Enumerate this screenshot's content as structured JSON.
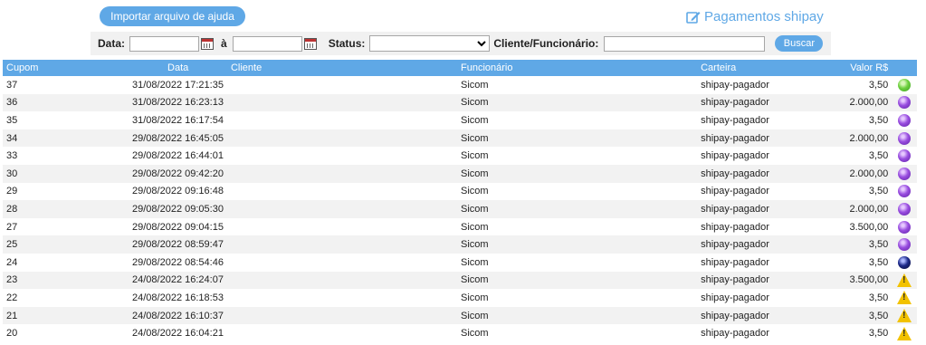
{
  "header": {
    "import_label": "Importar arquivo de ajuda",
    "shipay_label": "Pagamentos shipay",
    "shipay_icon": "edit-icon",
    "accent_color": "#5fa8e6"
  },
  "filters": {
    "data_label": "Data:",
    "data_from_value": "",
    "a_label": "à",
    "data_to_value": "",
    "status_label": "Status:",
    "status_selected": "",
    "cliente_label": "Cliente/Funcionário:",
    "cliente_value": "",
    "buscar_label": "Buscar"
  },
  "table": {
    "headers": {
      "cupom": "Cupom",
      "data": "Data",
      "cliente": "Cliente",
      "funcionario": "Funcionário",
      "carteira": "Carteira",
      "valor": "Valor R$"
    },
    "rows": [
      {
        "cupom": "37",
        "data": "31/08/2022 17:21:35",
        "cliente": "",
        "funcionario": "Sicom",
        "carteira": "shipay-pagador",
        "valor": "3,50",
        "status": "green"
      },
      {
        "cupom": "36",
        "data": "31/08/2022 16:23:13",
        "cliente": "",
        "funcionario": "Sicom",
        "carteira": "shipay-pagador",
        "valor": "2.000,00",
        "status": "purple"
      },
      {
        "cupom": "35",
        "data": "31/08/2022 16:17:54",
        "cliente": "",
        "funcionario": "Sicom",
        "carteira": "shipay-pagador",
        "valor": "3,50",
        "status": "purple"
      },
      {
        "cupom": "34",
        "data": "29/08/2022 16:45:05",
        "cliente": "",
        "funcionario": "Sicom",
        "carteira": "shipay-pagador",
        "valor": "2.000,00",
        "status": "purple"
      },
      {
        "cupom": "33",
        "data": "29/08/2022 16:44:01",
        "cliente": "",
        "funcionario": "Sicom",
        "carteira": "shipay-pagador",
        "valor": "3,50",
        "status": "purple"
      },
      {
        "cupom": "30",
        "data": "29/08/2022 09:42:20",
        "cliente": "",
        "funcionario": "Sicom",
        "carteira": "shipay-pagador",
        "valor": "2.000,00",
        "status": "purple"
      },
      {
        "cupom": "29",
        "data": "29/08/2022 09:16:48",
        "cliente": "",
        "funcionario": "Sicom",
        "carteira": "shipay-pagador",
        "valor": "3,50",
        "status": "purple"
      },
      {
        "cupom": "28",
        "data": "29/08/2022 09:05:30",
        "cliente": "",
        "funcionario": "Sicom",
        "carteira": "shipay-pagador",
        "valor": "2.000,00",
        "status": "purple"
      },
      {
        "cupom": "27",
        "data": "29/08/2022 09:04:15",
        "cliente": "",
        "funcionario": "Sicom",
        "carteira": "shipay-pagador",
        "valor": "3.500,00",
        "status": "purple"
      },
      {
        "cupom": "25",
        "data": "29/08/2022 08:59:47",
        "cliente": "",
        "funcionario": "Sicom",
        "carteira": "shipay-pagador",
        "valor": "3,50",
        "status": "purple"
      },
      {
        "cupom": "24",
        "data": "29/08/2022 08:54:46",
        "cliente": "",
        "funcionario": "Sicom",
        "carteira": "shipay-pagador",
        "valor": "3,50",
        "status": "navy"
      },
      {
        "cupom": "23",
        "data": "24/08/2022 16:24:07",
        "cliente": "",
        "funcionario": "Sicom",
        "carteira": "shipay-pagador",
        "valor": "3.500,00",
        "status": "warning"
      },
      {
        "cupom": "22",
        "data": "24/08/2022 16:18:53",
        "cliente": "",
        "funcionario": "Sicom",
        "carteira": "shipay-pagador",
        "valor": "3,50",
        "status": "warning"
      },
      {
        "cupom": "21",
        "data": "24/08/2022 16:10:37",
        "cliente": "",
        "funcionario": "Sicom",
        "carteira": "shipay-pagador",
        "valor": "3,50",
        "status": "warning"
      },
      {
        "cupom": "20",
        "data": "24/08/2022 16:04:21",
        "cliente": "",
        "funcionario": "Sicom",
        "carteira": "shipay-pagador",
        "valor": "3,50",
        "status": "warning"
      }
    ]
  }
}
